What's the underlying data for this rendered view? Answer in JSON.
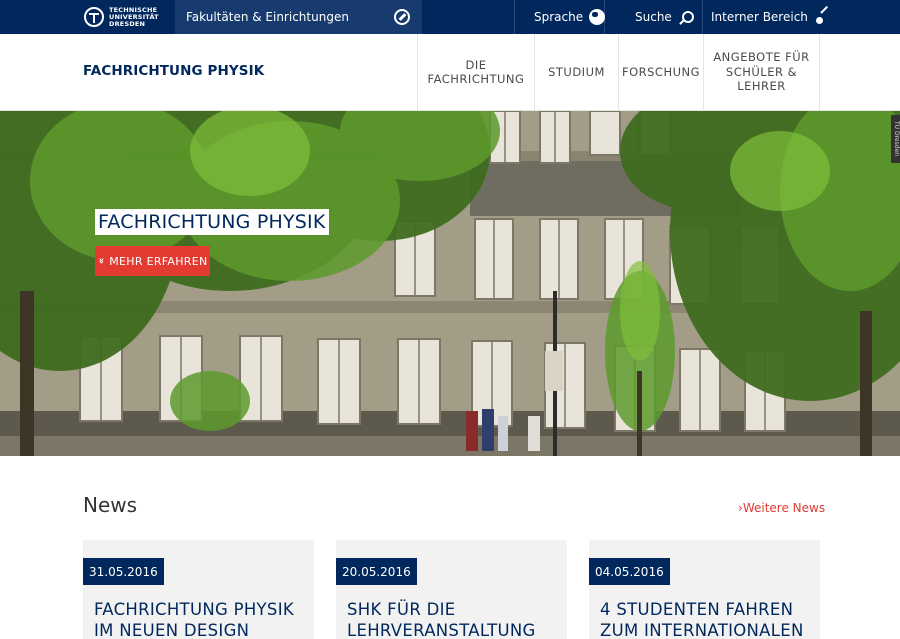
{
  "topbar": {
    "logo_lines": [
      "TECHNISCHE",
      "UNIVERSITÄT",
      "DRESDEN"
    ],
    "faculties_label": "Fakultäten & Einrichtungen",
    "language_label": "Sprache",
    "search_label": "Suche",
    "internal_label": "Interner Bereich"
  },
  "header": {
    "site_title": "FACHRICHTUNG PHYSIK",
    "nav": [
      {
        "label": "DIE\nFACHRICHTUNG"
      },
      {
        "label": "STUDIUM"
      },
      {
        "label": "FORSCHUNG"
      },
      {
        "label": "ANGEBOTE FÜR\nSCHÜLER &\nLEHRER"
      }
    ]
  },
  "hero": {
    "title": "FACHRICHTUNG PHYSIK",
    "button_label": "MEHR ERFAHREN",
    "photo_credit": "TU Dresden"
  },
  "news": {
    "heading": "News",
    "more_link": "Weitere News",
    "cards": [
      {
        "date": "31.05.2016",
        "title": "FACHRICHTUNG PHYSIK IM NEUEN DESIGN"
      },
      {
        "date": "20.05.2016",
        "title": "SHK FÜR DIE LEHRVERANSTALTUNG"
      },
      {
        "date": "04.05.2016",
        "title": "4 STUDENTEN FAHREN ZUM INTERNATIONALEN"
      }
    ]
  },
  "colors": {
    "primary": "#00285c",
    "accent": "#e33b32"
  }
}
